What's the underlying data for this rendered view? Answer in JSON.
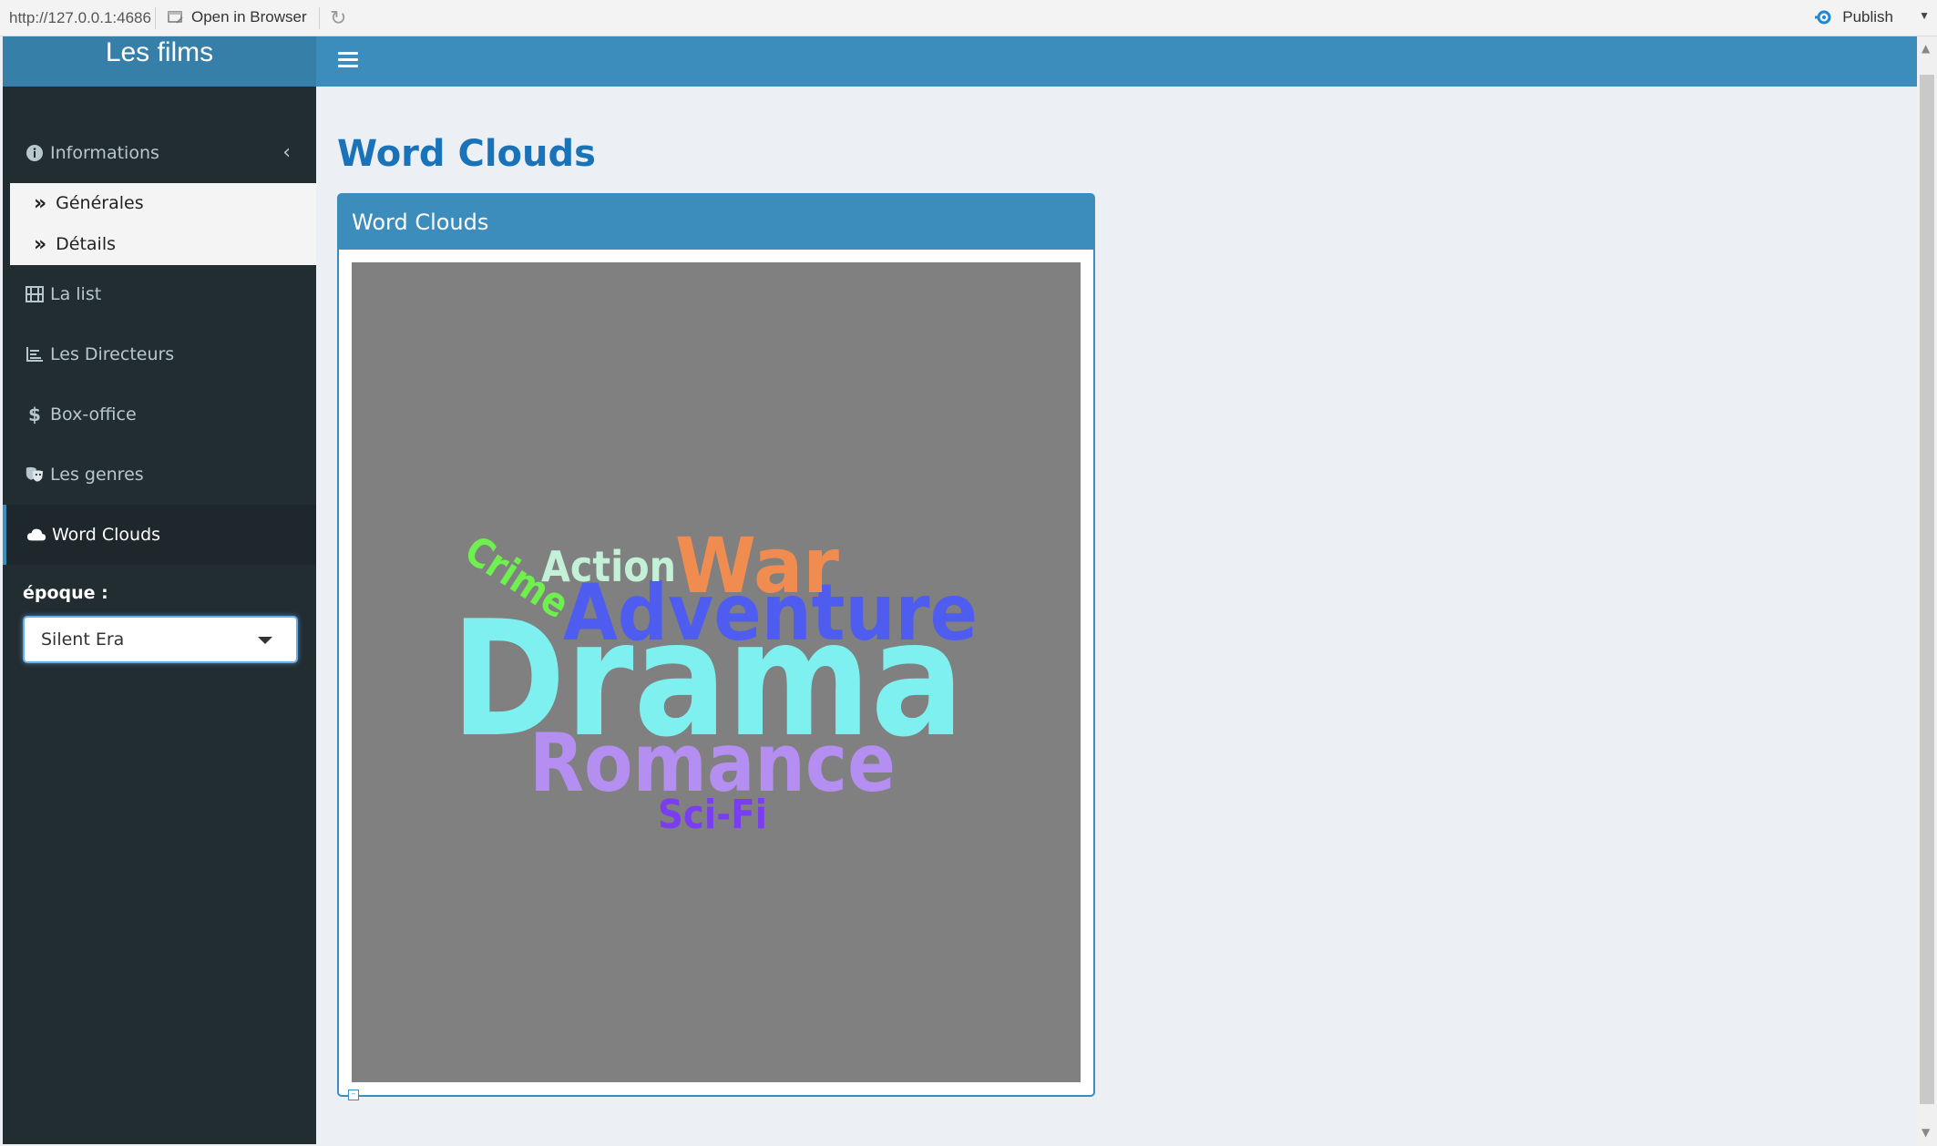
{
  "browser_bar": {
    "url": "http://127.0.0.1:4686",
    "open_in_browser": "Open in Browser",
    "publish": "Publish"
  },
  "sidebar": {
    "logo": "Les films",
    "menu": [
      {
        "label": "Informations",
        "icon": "info-circle-icon"
      },
      {
        "label": "La list",
        "icon": "film-icon"
      },
      {
        "label": "Les Directeurs",
        "icon": "chart-icon"
      },
      {
        "label": "Box-office",
        "icon": "dollar-icon"
      },
      {
        "label": "Les genres",
        "icon": "theater-masks-icon"
      },
      {
        "label": "Word Clouds",
        "icon": "cloud-icon",
        "active": true
      }
    ],
    "submenu": [
      {
        "label": "Générales",
        "icon": "double-chevron-right-icon"
      },
      {
        "label": "Détails",
        "icon": "double-chevron-right-icon"
      }
    ],
    "epoque_label": "époque :",
    "epoque_selected": "Silent Era"
  },
  "main": {
    "title": "Word Clouds",
    "box_title": "Word Clouds",
    "word_cloud": {
      "background": "#808080",
      "words": [
        {
          "text": "Drama",
          "color": "#7ff0f0"
        },
        {
          "text": "Adventure",
          "color": "#4f5cf0"
        },
        {
          "text": "Romance",
          "color": "#b48ef0"
        },
        {
          "text": "War",
          "color": "#f08c4f"
        },
        {
          "text": "Action",
          "color": "#c4f0d8"
        },
        {
          "text": "Crime",
          "color": "#6ef04e"
        },
        {
          "text": "Sci-Fi",
          "color": "#7a3ef0"
        }
      ]
    }
  },
  "colors": {
    "header": "#3c8dbc",
    "sidebar": "#222d32",
    "title": "#1a73b8"
  }
}
